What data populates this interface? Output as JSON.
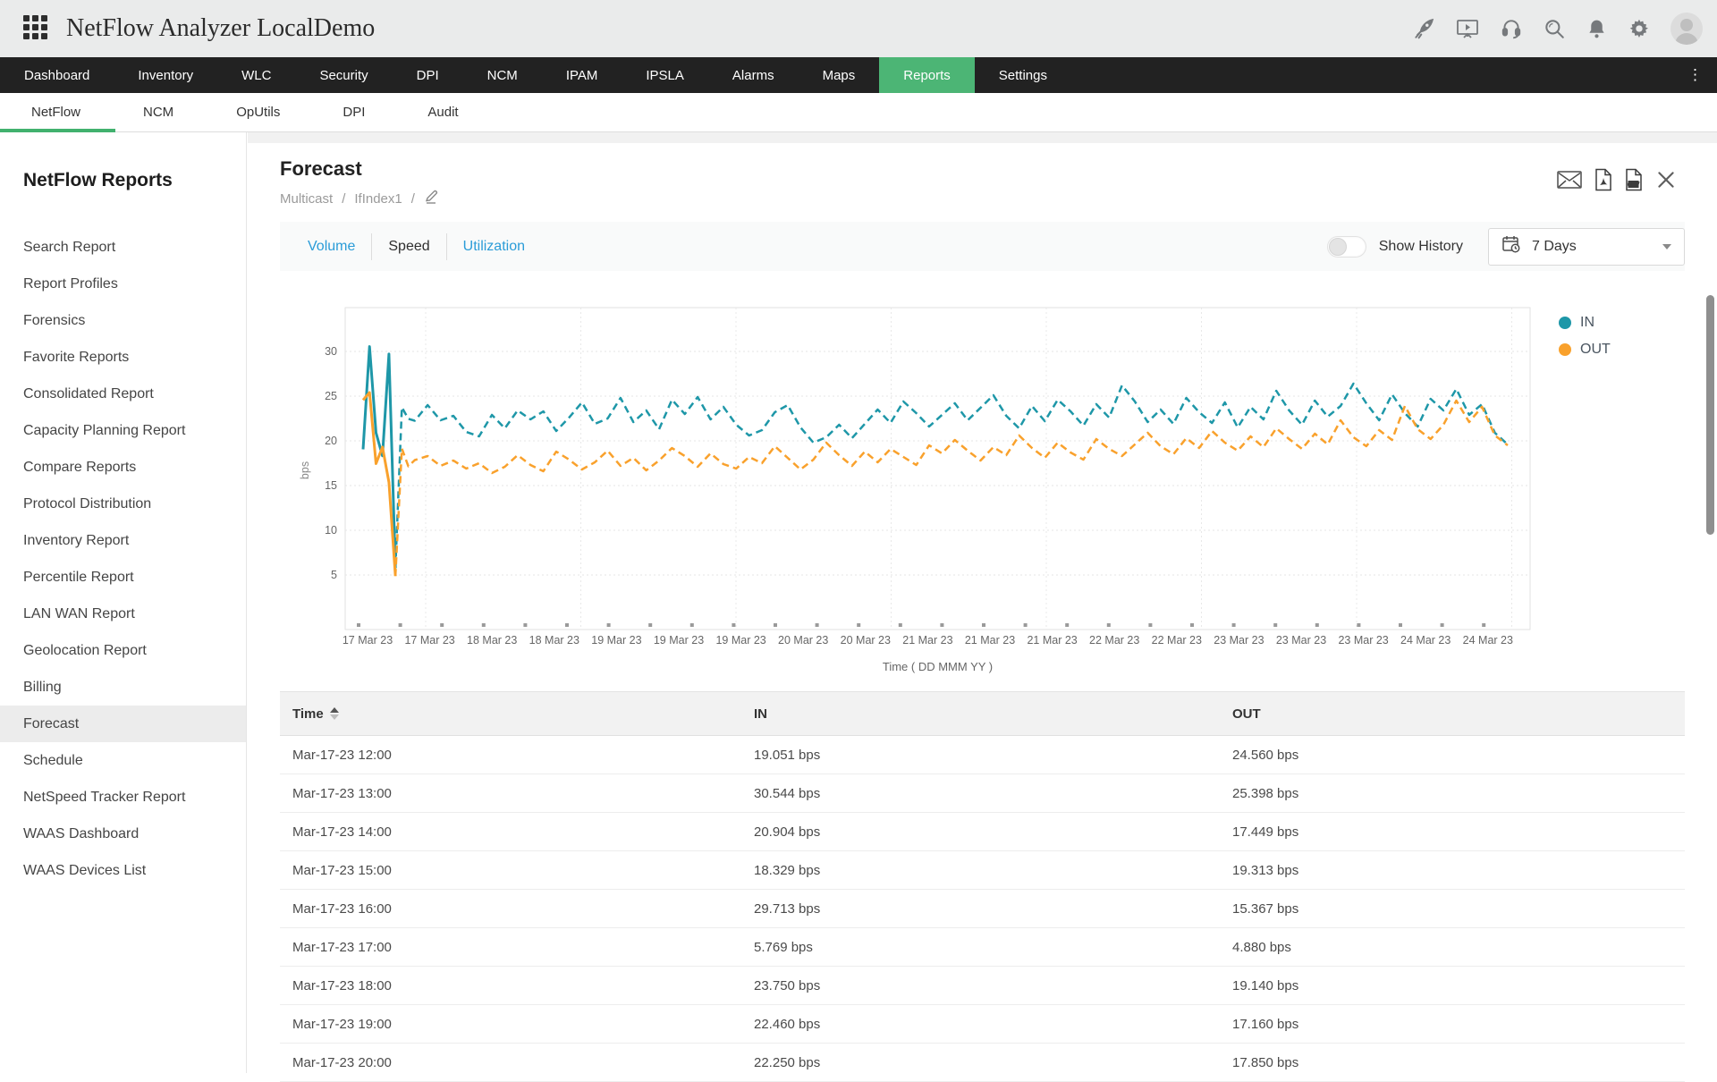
{
  "header": {
    "title": "NetFlow Analyzer LocalDemo",
    "icons": [
      "app-launcher",
      "getting-started-rocket",
      "demo-video",
      "support-headset",
      "search",
      "notifications-bell",
      "settings-gear",
      "user-account"
    ]
  },
  "nav": {
    "items": [
      {
        "label": "Dashboard",
        "active": false
      },
      {
        "label": "Inventory",
        "active": false
      },
      {
        "label": "WLC",
        "active": false
      },
      {
        "label": "Security",
        "active": false
      },
      {
        "label": "DPI",
        "active": false
      },
      {
        "label": "NCM",
        "active": false
      },
      {
        "label": "IPAM",
        "active": false
      },
      {
        "label": "IPSLA",
        "active": false
      },
      {
        "label": "Alarms",
        "active": false
      },
      {
        "label": "Maps",
        "active": false
      },
      {
        "label": "Reports",
        "active": true
      },
      {
        "label": "Settings",
        "active": false
      }
    ],
    "active_color": "#4cb575"
  },
  "subnav": {
    "items": [
      {
        "label": "NetFlow",
        "active": true
      },
      {
        "label": "NCM",
        "active": false
      },
      {
        "label": "OpUtils",
        "active": false
      },
      {
        "label": "DPI",
        "active": false
      },
      {
        "label": "Audit",
        "active": false
      }
    ]
  },
  "sidebar": {
    "title": "NetFlow Reports",
    "items": [
      {
        "label": "Search Report",
        "selected": false
      },
      {
        "label": "Report Profiles",
        "selected": false
      },
      {
        "label": "Forensics",
        "selected": false
      },
      {
        "label": "Favorite Reports",
        "selected": false
      },
      {
        "label": "Consolidated Report",
        "selected": false
      },
      {
        "label": "Capacity Planning Report",
        "selected": false
      },
      {
        "label": "Compare Reports",
        "selected": false
      },
      {
        "label": "Protocol Distribution",
        "selected": false
      },
      {
        "label": "Inventory Report",
        "selected": false
      },
      {
        "label": "Percentile Report",
        "selected": false
      },
      {
        "label": "LAN WAN Report",
        "selected": false
      },
      {
        "label": "Geolocation Report",
        "selected": false
      },
      {
        "label": "Billing",
        "selected": false
      },
      {
        "label": "Forecast",
        "selected": true
      },
      {
        "label": "Schedule",
        "selected": false
      },
      {
        "label": "NetSpeed Tracker Report",
        "selected": false
      },
      {
        "label": "WAAS Dashboard",
        "selected": false
      },
      {
        "label": "WAAS Devices List",
        "selected": false
      }
    ]
  },
  "report": {
    "title": "Forecast",
    "breadcrumb": [
      "Multicast",
      "IfIndex1"
    ],
    "export_icons": [
      "email",
      "export-pdf",
      "export-csv",
      "close"
    ],
    "tabs": [
      {
        "label": "Volume",
        "state": "link"
      },
      {
        "label": "Speed",
        "state": "active"
      },
      {
        "label": "Utilization",
        "state": "link"
      }
    ],
    "show_history_label": "Show History",
    "show_history_on": false,
    "period": "7 Days"
  },
  "chart_data": {
    "type": "line",
    "title": "",
    "ylabel": "bps",
    "xlabel": "Time ( DD MMM YY )",
    "yticks": [
      5,
      10,
      15,
      20,
      25,
      30
    ],
    "ylim": [
      0,
      35
    ],
    "grid": true,
    "legend_position": "right",
    "x_labels": [
      "17 Mar 23",
      "17 Mar 23",
      "18 Mar 23",
      "18 Mar 23",
      "19 Mar 23",
      "19 Mar 23",
      "19 Mar 23",
      "20 Mar 23",
      "20 Mar 23",
      "21 Mar 23",
      "21 Mar 23",
      "21 Mar 23",
      "22 Mar 23",
      "22 Mar 23",
      "23 Mar 23",
      "23 Mar 23",
      "23 Mar 23",
      "24 Mar 23",
      "24 Mar 23"
    ],
    "history_times": [
      "Mar-17-23 12:00",
      "Mar-17-23 13:00",
      "Mar-17-23 14:00",
      "Mar-17-23 15:00",
      "Mar-17-23 16:00",
      "Mar-17-23 17:00",
      "Mar-17-23 18:00",
      "Mar-17-23 19:00",
      "Mar-17-23 20:00"
    ],
    "series": [
      {
        "name": "IN",
        "color": "#1e97a8",
        "history": [
          19.051,
          30.544,
          20.904,
          18.329,
          29.713,
          5.769,
          23.75,
          22.46,
          22.25
        ],
        "forecast": [
          24.0,
          22.3,
          22.8,
          21.0,
          20.5,
          22.9,
          21.4,
          23.4,
          22.4,
          23.3,
          21.1,
          22.6,
          24.3,
          21.9,
          22.5,
          24.8,
          22.1,
          23.4,
          21.3,
          24.6,
          23.0,
          24.9,
          22.4,
          23.8,
          21.8,
          20.6,
          21.2,
          23.2,
          24.0,
          21.5,
          19.8,
          20.4,
          21.8,
          20.3,
          21.9,
          23.5,
          22.0,
          24.4,
          23.1,
          21.6,
          22.9,
          24.2,
          22.3,
          23.7,
          25.1,
          22.8,
          21.4,
          23.9,
          22.2,
          24.6,
          23.3,
          21.7,
          24.1,
          22.6,
          26.2,
          24.4,
          22.1,
          23.5,
          21.9,
          24.8,
          23.2,
          22.0,
          24.3,
          21.5,
          23.8,
          22.4,
          25.6,
          23.4,
          21.8,
          24.5,
          22.7,
          23.9,
          26.4,
          24.2,
          22.3,
          25.2,
          23.1,
          21.6,
          24.7,
          23.4,
          25.8,
          22.9,
          24.1,
          20.9,
          19.6
        ]
      },
      {
        "name": "OUT",
        "color": "#f9a12c",
        "history": [
          24.56,
          25.398,
          17.449,
          19.313,
          15.367,
          4.88,
          19.14,
          17.16,
          17.85
        ],
        "forecast": [
          18.3,
          17.2,
          17.8,
          16.9,
          17.5,
          16.4,
          17.1,
          18.4,
          17.3,
          16.6,
          18.8,
          17.9,
          16.8,
          17.6,
          18.9,
          17.2,
          18.1,
          16.7,
          17.8,
          19.2,
          18.3,
          17.1,
          18.6,
          17.4,
          16.9,
          18.2,
          17.5,
          19.4,
          18.1,
          16.8,
          17.9,
          19.8,
          18.4,
          17.2,
          18.8,
          17.6,
          19.1,
          18.2,
          17.3,
          19.5,
          18.6,
          20.1,
          18.9,
          17.8,
          19.3,
          18.4,
          20.6,
          19.2,
          18.1,
          19.8,
          18.7,
          17.9,
          20.2,
          19.1,
          18.3,
          19.6,
          20.9,
          19.4,
          18.5,
          20.3,
          19.2,
          21.1,
          19.8,
          18.9,
          20.5,
          19.3,
          21.4,
          20.2,
          19.1,
          20.8,
          19.6,
          22.3,
          20.4,
          19.4,
          21.2,
          20.1,
          23.9,
          21.3,
          20.2,
          21.8,
          24.5,
          22.1,
          23.8,
          20.6,
          19.5
        ]
      }
    ]
  },
  "table": {
    "columns": [
      "Time",
      "IN",
      "OUT"
    ],
    "sorted_by": "Time",
    "rows": [
      [
        "Mar-17-23 12:00",
        "19.051 bps",
        "24.560 bps"
      ],
      [
        "Mar-17-23 13:00",
        "30.544 bps",
        "25.398 bps"
      ],
      [
        "Mar-17-23 14:00",
        "20.904 bps",
        "17.449 bps"
      ],
      [
        "Mar-17-23 15:00",
        "18.329 bps",
        "19.313 bps"
      ],
      [
        "Mar-17-23 16:00",
        "29.713 bps",
        "15.367 bps"
      ],
      [
        "Mar-17-23 17:00",
        "5.769 bps",
        "4.880 bps"
      ],
      [
        "Mar-17-23 18:00",
        "23.750 bps",
        "19.140 bps"
      ],
      [
        "Mar-17-23 19:00",
        "22.460 bps",
        "17.160 bps"
      ],
      [
        "Mar-17-23 20:00",
        "22.250 bps",
        "17.850 bps"
      ]
    ]
  },
  "colors": {
    "nav_bg": "#222222",
    "nav_active": "#4cb575",
    "subnav_underline": "#41b16e",
    "link_blue": "#2b9cd8",
    "series_in": "#1e97a8",
    "series_out": "#f9a12c",
    "sidebar_selected_bg": "#ececec",
    "table_header_bg": "#f2f2f2"
  }
}
